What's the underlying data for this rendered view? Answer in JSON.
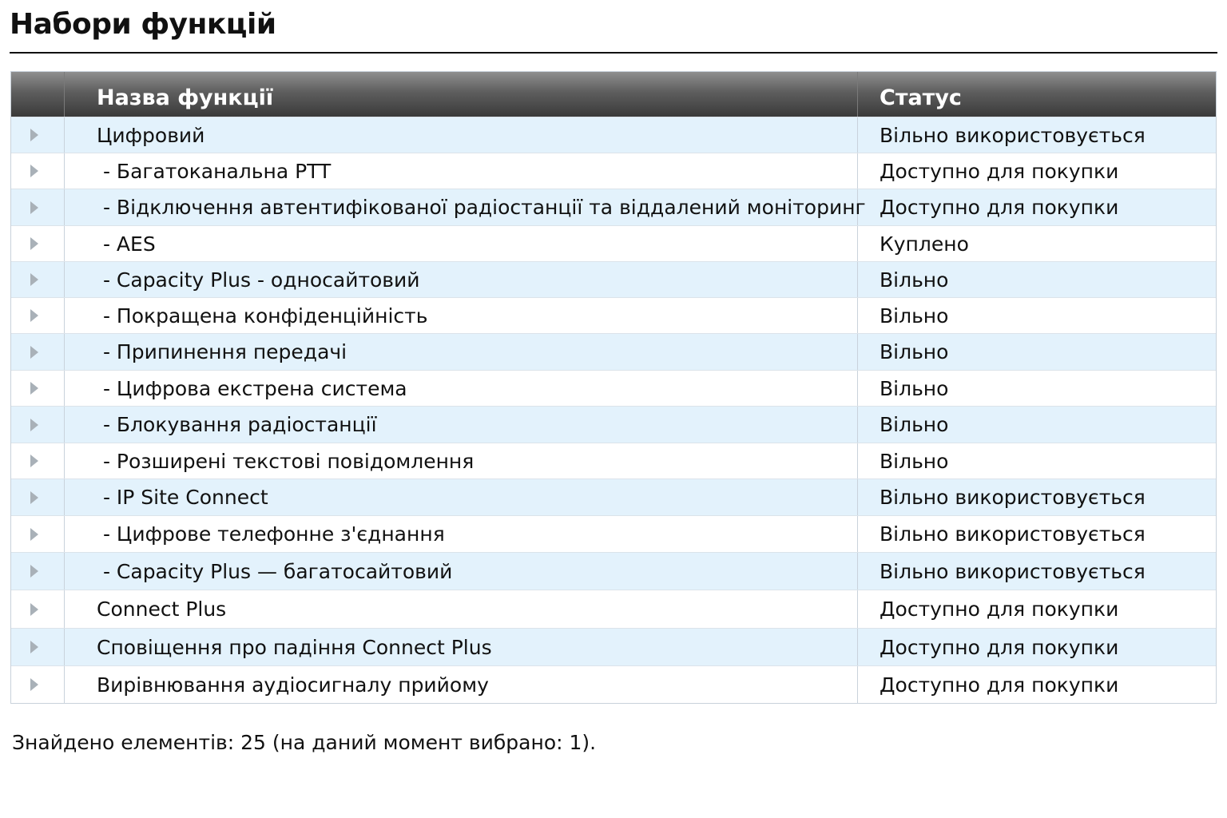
{
  "page": {
    "title": "Набори функцій"
  },
  "table": {
    "columns": {
      "name": "Назва функції",
      "status": "Статус"
    },
    "rows": [
      {
        "name": "Цифровий",
        "status": "Вільно використовується"
      },
      {
        "name": " - Багатоканальна PTT",
        "status": "Доступно для покупки"
      },
      {
        "name": " - Відключення автентифікованої радіостанції та віддалений моніторинг",
        "status": "Доступно для покупки"
      },
      {
        "name": " - AES",
        "status": "Куплено"
      },
      {
        "name": " - Capacity Plus - односайтовий",
        "status": "Вільно"
      },
      {
        "name": " - Покращена конфіденційність",
        "status": "Вільно"
      },
      {
        "name": " - Припинення передачі",
        "status": "Вільно"
      },
      {
        "name": " - Цифрова екстрена система",
        "status": "Вільно"
      },
      {
        "name": " - Блокування радіостанції",
        "status": "Вільно"
      },
      {
        "name": " - Розширені текстові повідомлення",
        "status": "Вільно"
      },
      {
        "name": " - IP Site Connect",
        "status": "Вільно використовується"
      },
      {
        "name": " - Цифрове телефонне з'єднання",
        "status": "Вільно використовується"
      },
      {
        "name": " - Capacity Plus — багатосайтовий",
        "status": "Вільно використовується"
      },
      {
        "name": "Connect Plus",
        "status": "Доступно для покупки"
      },
      {
        "name": "Сповіщення про падіння Connect Plus",
        "status": "Доступно для покупки"
      },
      {
        "name": "Вирівнювання аудіосигналу прийому",
        "status": "Доступно для покупки"
      }
    ]
  },
  "footer": {
    "summary": "Знайдено елементів: 25 (на даний момент вибрано: 1)."
  },
  "colors": {
    "row_alt": "#e3f2fc",
    "header_dark": "#3a3a3a",
    "arrow": "#a9b1b8"
  },
  "icons": {
    "row_expander": "triangle-right-icon"
  }
}
